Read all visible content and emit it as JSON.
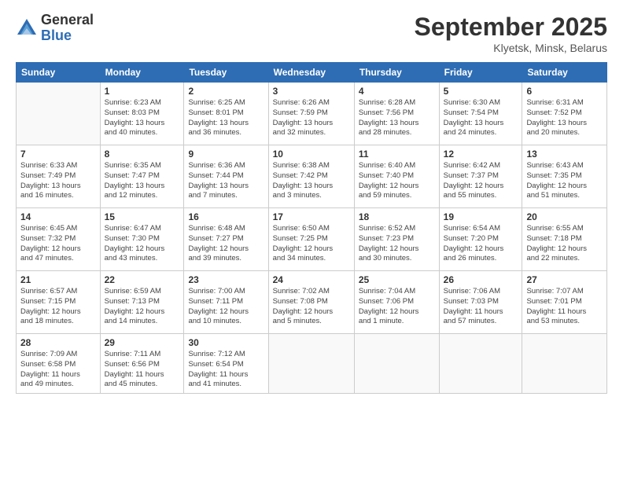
{
  "logo": {
    "general": "General",
    "blue": "Blue"
  },
  "title": "September 2025",
  "location": "Klyetsk, Minsk, Belarus",
  "days_of_week": [
    "Sunday",
    "Monday",
    "Tuesday",
    "Wednesday",
    "Thursday",
    "Friday",
    "Saturday"
  ],
  "weeks": [
    [
      {
        "day": "",
        "info": ""
      },
      {
        "day": "1",
        "info": "Sunrise: 6:23 AM\nSunset: 8:03 PM\nDaylight: 13 hours\nand 40 minutes."
      },
      {
        "day": "2",
        "info": "Sunrise: 6:25 AM\nSunset: 8:01 PM\nDaylight: 13 hours\nand 36 minutes."
      },
      {
        "day": "3",
        "info": "Sunrise: 6:26 AM\nSunset: 7:59 PM\nDaylight: 13 hours\nand 32 minutes."
      },
      {
        "day": "4",
        "info": "Sunrise: 6:28 AM\nSunset: 7:56 PM\nDaylight: 13 hours\nand 28 minutes."
      },
      {
        "day": "5",
        "info": "Sunrise: 6:30 AM\nSunset: 7:54 PM\nDaylight: 13 hours\nand 24 minutes."
      },
      {
        "day": "6",
        "info": "Sunrise: 6:31 AM\nSunset: 7:52 PM\nDaylight: 13 hours\nand 20 minutes."
      }
    ],
    [
      {
        "day": "7",
        "info": "Sunrise: 6:33 AM\nSunset: 7:49 PM\nDaylight: 13 hours\nand 16 minutes."
      },
      {
        "day": "8",
        "info": "Sunrise: 6:35 AM\nSunset: 7:47 PM\nDaylight: 13 hours\nand 12 minutes."
      },
      {
        "day": "9",
        "info": "Sunrise: 6:36 AM\nSunset: 7:44 PM\nDaylight: 13 hours\nand 7 minutes."
      },
      {
        "day": "10",
        "info": "Sunrise: 6:38 AM\nSunset: 7:42 PM\nDaylight: 13 hours\nand 3 minutes."
      },
      {
        "day": "11",
        "info": "Sunrise: 6:40 AM\nSunset: 7:40 PM\nDaylight: 12 hours\nand 59 minutes."
      },
      {
        "day": "12",
        "info": "Sunrise: 6:42 AM\nSunset: 7:37 PM\nDaylight: 12 hours\nand 55 minutes."
      },
      {
        "day": "13",
        "info": "Sunrise: 6:43 AM\nSunset: 7:35 PM\nDaylight: 12 hours\nand 51 minutes."
      }
    ],
    [
      {
        "day": "14",
        "info": "Sunrise: 6:45 AM\nSunset: 7:32 PM\nDaylight: 12 hours\nand 47 minutes."
      },
      {
        "day": "15",
        "info": "Sunrise: 6:47 AM\nSunset: 7:30 PM\nDaylight: 12 hours\nand 43 minutes."
      },
      {
        "day": "16",
        "info": "Sunrise: 6:48 AM\nSunset: 7:27 PM\nDaylight: 12 hours\nand 39 minutes."
      },
      {
        "day": "17",
        "info": "Sunrise: 6:50 AM\nSunset: 7:25 PM\nDaylight: 12 hours\nand 34 minutes."
      },
      {
        "day": "18",
        "info": "Sunrise: 6:52 AM\nSunset: 7:23 PM\nDaylight: 12 hours\nand 30 minutes."
      },
      {
        "day": "19",
        "info": "Sunrise: 6:54 AM\nSunset: 7:20 PM\nDaylight: 12 hours\nand 26 minutes."
      },
      {
        "day": "20",
        "info": "Sunrise: 6:55 AM\nSunset: 7:18 PM\nDaylight: 12 hours\nand 22 minutes."
      }
    ],
    [
      {
        "day": "21",
        "info": "Sunrise: 6:57 AM\nSunset: 7:15 PM\nDaylight: 12 hours\nand 18 minutes."
      },
      {
        "day": "22",
        "info": "Sunrise: 6:59 AM\nSunset: 7:13 PM\nDaylight: 12 hours\nand 14 minutes."
      },
      {
        "day": "23",
        "info": "Sunrise: 7:00 AM\nSunset: 7:11 PM\nDaylight: 12 hours\nand 10 minutes."
      },
      {
        "day": "24",
        "info": "Sunrise: 7:02 AM\nSunset: 7:08 PM\nDaylight: 12 hours\nand 5 minutes."
      },
      {
        "day": "25",
        "info": "Sunrise: 7:04 AM\nSunset: 7:06 PM\nDaylight: 12 hours\nand 1 minute."
      },
      {
        "day": "26",
        "info": "Sunrise: 7:06 AM\nSunset: 7:03 PM\nDaylight: 11 hours\nand 57 minutes."
      },
      {
        "day": "27",
        "info": "Sunrise: 7:07 AM\nSunset: 7:01 PM\nDaylight: 11 hours\nand 53 minutes."
      }
    ],
    [
      {
        "day": "28",
        "info": "Sunrise: 7:09 AM\nSunset: 6:58 PM\nDaylight: 11 hours\nand 49 minutes."
      },
      {
        "day": "29",
        "info": "Sunrise: 7:11 AM\nSunset: 6:56 PM\nDaylight: 11 hours\nand 45 minutes."
      },
      {
        "day": "30",
        "info": "Sunrise: 7:12 AM\nSunset: 6:54 PM\nDaylight: 11 hours\nand 41 minutes."
      },
      {
        "day": "",
        "info": ""
      },
      {
        "day": "",
        "info": ""
      },
      {
        "day": "",
        "info": ""
      },
      {
        "day": "",
        "info": ""
      }
    ]
  ]
}
